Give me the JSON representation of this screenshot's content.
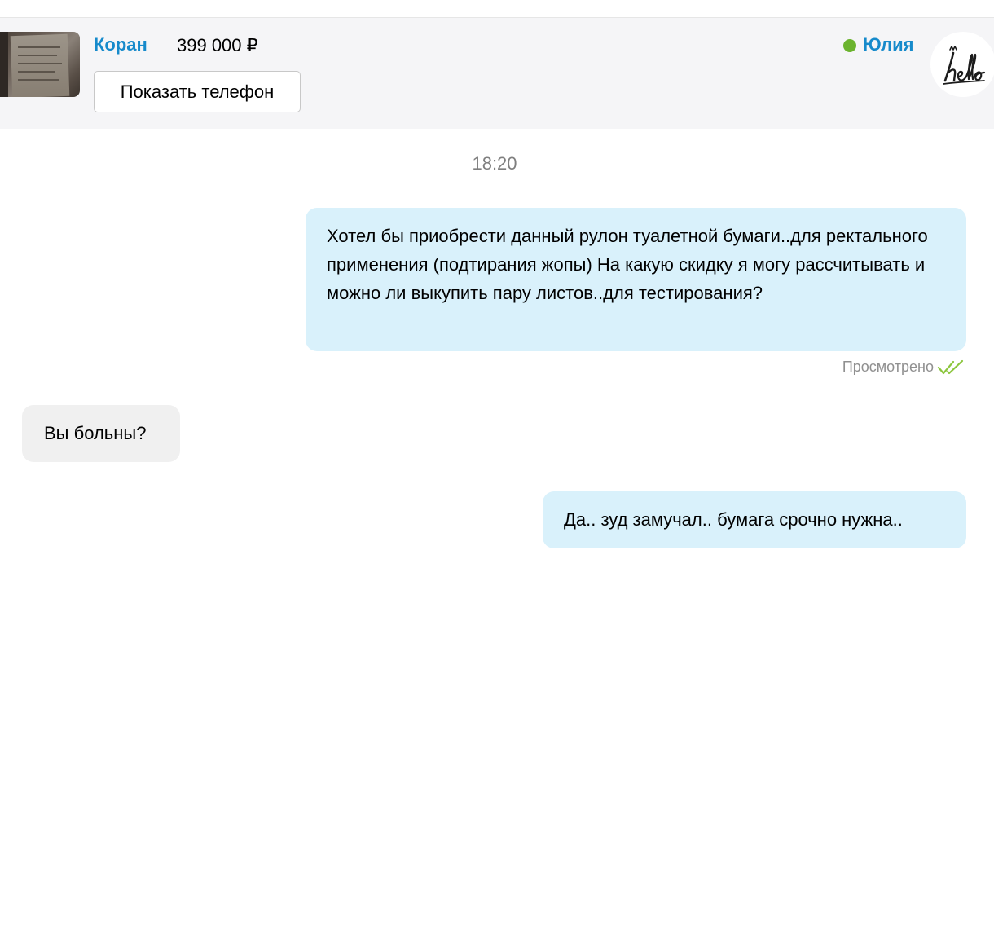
{
  "listing": {
    "title": "Коран",
    "price": "399 000 ₽",
    "show_phone_label": "Показать телефон",
    "thumbnail_icon": "book-photo"
  },
  "seller": {
    "name": "Юлия",
    "online": true,
    "online_color": "#6bb32e",
    "avatar_text": "hello"
  },
  "colors": {
    "link": "#168acb",
    "outgoing_bubble": "#d9f1fb",
    "incoming_bubble": "#f0f0f0",
    "read_check": "#8dc63f"
  },
  "chat": {
    "timestamp": "18:20",
    "messages": [
      {
        "direction": "outgoing",
        "text": "Хотел бы приобрести данный рулон туалетной бумаги..для ректального применения (подтирания жопы) На какую скидку я могу рассчитывать и можно ли выкупить пару листов..для тестирования?",
        "status": "Просмотрено"
      },
      {
        "direction": "incoming",
        "text": "Вы больны?"
      },
      {
        "direction": "outgoing",
        "text": "Да.. зуд замучал.. бумага срочно нужна.."
      }
    ]
  }
}
